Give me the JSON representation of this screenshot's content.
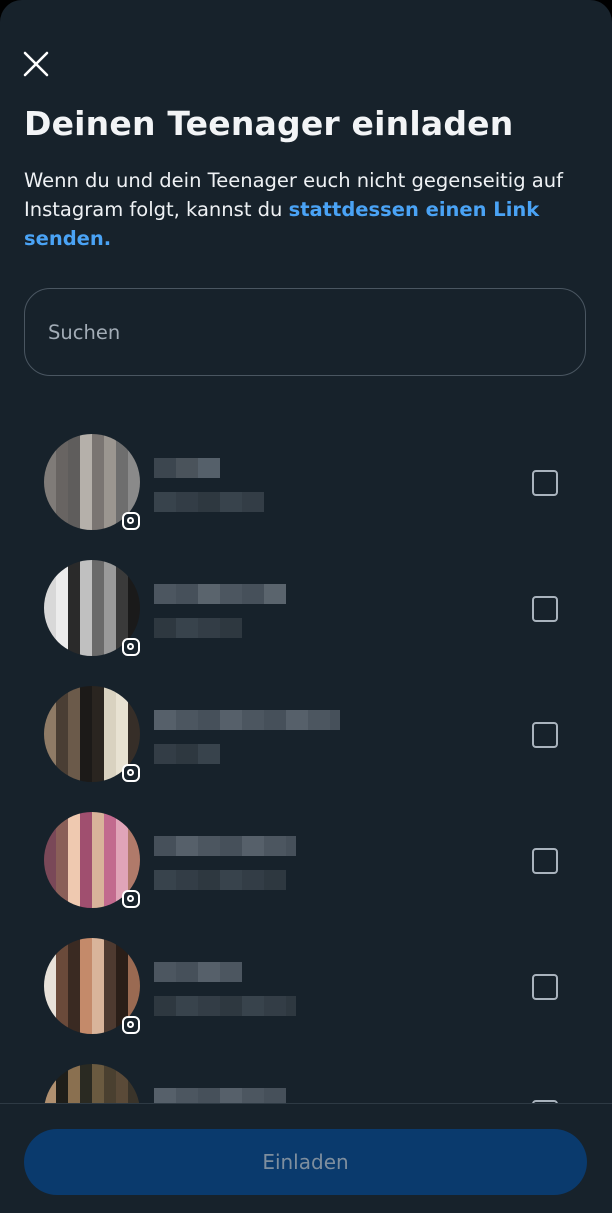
{
  "header": {
    "close_icon": "close-icon",
    "title": "Deinen Teenager einladen",
    "description_text": "Wenn du und dein Teenager euch nicht gegenseitig auf Instagram folgt, kannst du ",
    "description_link": "stattdessen einen Link senden."
  },
  "search": {
    "placeholder": "Suchen",
    "value": ""
  },
  "contacts": [
    {
      "name": "",
      "username": "",
      "checked": false,
      "source_icon": "instagram-icon"
    },
    {
      "name": "",
      "username": "",
      "checked": false,
      "source_icon": "instagram-icon"
    },
    {
      "name": "",
      "username": "",
      "checked": false,
      "source_icon": "instagram-icon"
    },
    {
      "name": "",
      "username": "",
      "checked": false,
      "source_icon": "instagram-icon"
    },
    {
      "name": "",
      "username": "",
      "checked": false,
      "source_icon": "instagram-icon"
    },
    {
      "name": "",
      "username": "",
      "checked": false,
      "source_icon": "instagram-icon"
    }
  ],
  "footer": {
    "invite_label": "Einladen",
    "invite_enabled": false
  },
  "colors": {
    "background": "#17222b",
    "link": "#4aa3f5",
    "button_disabled": "#0a3a6d",
    "button_text_disabled": "#7e8e9e"
  }
}
